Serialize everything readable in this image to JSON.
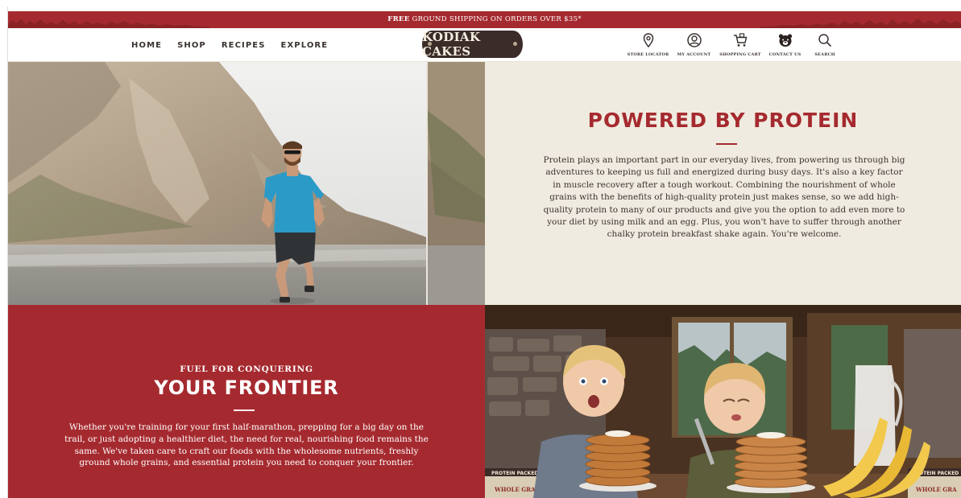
{
  "announcement": {
    "bold": "FREE",
    "text": " GROUND SHIPPING ON ORDERS OVER $35*"
  },
  "nav": {
    "items": [
      "HOME",
      "SHOP",
      "RECIPES",
      "EXPLORE"
    ]
  },
  "logo": {
    "text": "KODIAK CAKES"
  },
  "utility": [
    {
      "label": "STORE LOCATOR",
      "icon": "map-pin-icon"
    },
    {
      "label": "MY ACCOUNT",
      "icon": "user-icon"
    },
    {
      "label": "SHOPPING CART",
      "icon": "cart-icon"
    },
    {
      "label": "CONTACT US",
      "icon": "bear-icon"
    },
    {
      "label": "SEARCH",
      "icon": "search-icon"
    }
  ],
  "protein": {
    "title": "POWERED BY PROTEIN",
    "body": "Protein plays an important part in our everyday lives, from powering us through big adventures to keeping us full and energized during busy days. It's also a key factor in muscle recovery after a tough workout. Combining the nourishment of whole grains with the benefits of high-quality protein just makes sense, so we add high-quality protein to many of our products and give you the option to add even more to your diet by using milk and an egg. Plus, you won't have to suffer through another chalky protein breakfast shake again. You're welcome."
  },
  "frontier": {
    "eyebrow": "FUEL FOR CONQUERING",
    "title": "YOUR FRONTIER",
    "body": "Whether you're training for your first half-marathon, prepping for a big day on the trail, or just adopting a healthier diet, the need for real, nourishing food remains the same. We've taken care to craft our foods with the wholesome nutrients, freshly ground whole grains, and essential protein you need to conquer your frontier."
  },
  "kids_photo": {
    "box_labels": [
      "PROTEIN PACKED",
      "WHOLE GRAINS",
      "PROTEIN PACKED",
      "WHOLE GRA"
    ]
  },
  "colors": {
    "brand_red": "#a52a2f",
    "cream": "#f0ebe0",
    "logo_brown": "#3b2c29"
  }
}
